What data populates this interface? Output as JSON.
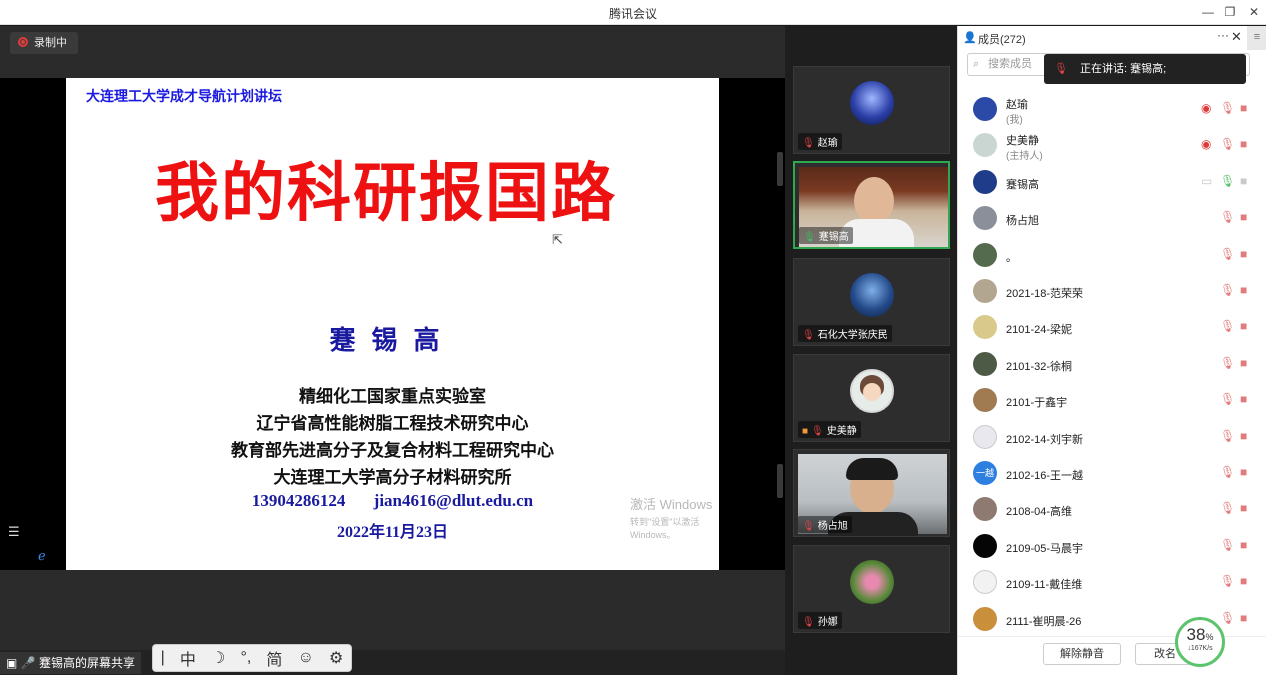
{
  "window": {
    "title": "腾讯会议"
  },
  "recording": {
    "label": "录制中"
  },
  "slide": {
    "header": "大连理工大学成才导航计划讲坛",
    "title": "我的科研报国路",
    "name": "蹇锡高",
    "lines": [
      "精细化工国家重点实验室",
      "辽宁省高性能树脂工程技术研究中心",
      "教育部先进高分子及复合材料工程研究中心",
      "大连理工大学高分子材料研究所"
    ],
    "phone": "13904286124",
    "email": "jian4616@dlut.edu.cn",
    "date": "2022年11月23日"
  },
  "watermark": {
    "line1": "激活 Windows",
    "line2": "转到\"设置\"以激活 Windows。"
  },
  "share_label": "蹇锡高的屏幕共享",
  "ime_toolbar": [
    "|",
    "中",
    "☽",
    "°,",
    "简",
    "☺",
    "⚙"
  ],
  "gallery": [
    {
      "name": "赵瑜"
    },
    {
      "name": "蹇锡高"
    },
    {
      "name": "石化大学张庆民"
    },
    {
      "name": "史美静"
    },
    {
      "name": "杨占旭"
    },
    {
      "name": "孙娜"
    }
  ],
  "panel": {
    "title": "成员(272)",
    "search_placeholder": "搜索成员",
    "speaking": "正在讲话: 蹇锡高;",
    "members": [
      {
        "name": "赵瑜",
        "role": "(我)",
        "av": "#2b4aa8"
      },
      {
        "name": "史美静",
        "role": "(主持人)",
        "av": "#c9d6d2"
      },
      {
        "name": "蹇锡高",
        "role": "",
        "av": "#1f3c8a"
      },
      {
        "name": "杨占旭",
        "role": "",
        "av": "#8a8f9a"
      },
      {
        "name": "。",
        "role": "",
        "av": "#556b4d"
      },
      {
        "name": "2021-18-范荣荣",
        "role": "",
        "av": "#b3a690"
      },
      {
        "name": "2101-24-梁妮",
        "role": "",
        "av": "#d9c98a"
      },
      {
        "name": "2101-32-徐桐",
        "role": "",
        "av": "#4d5a45"
      },
      {
        "name": "2101-于鑫宇",
        "role": "",
        "av": "#a07a50"
      },
      {
        "name": "2102-14-刘宇新",
        "role": "",
        "av": "#e8e8ee"
      },
      {
        "name": "2102-16-王一越",
        "role": "",
        "av": "#2f7fe0",
        "text": "一越"
      },
      {
        "name": "2108-04-高维",
        "role": "",
        "av": "#8e7a70"
      },
      {
        "name": "2109-05-马晨宇",
        "role": "",
        "av": "#050505"
      },
      {
        "name": "2109-11-戴佳维",
        "role": "",
        "av": "#f2f2f2"
      },
      {
        "name": "2111-崔明晨-26",
        "role": "",
        "av": "#c98f3a"
      }
    ],
    "unmute_all": "解除静音",
    "rename": "改名"
  },
  "network": {
    "percent": "38",
    "percent_unit": "%",
    "speed": "↓167K/s"
  }
}
